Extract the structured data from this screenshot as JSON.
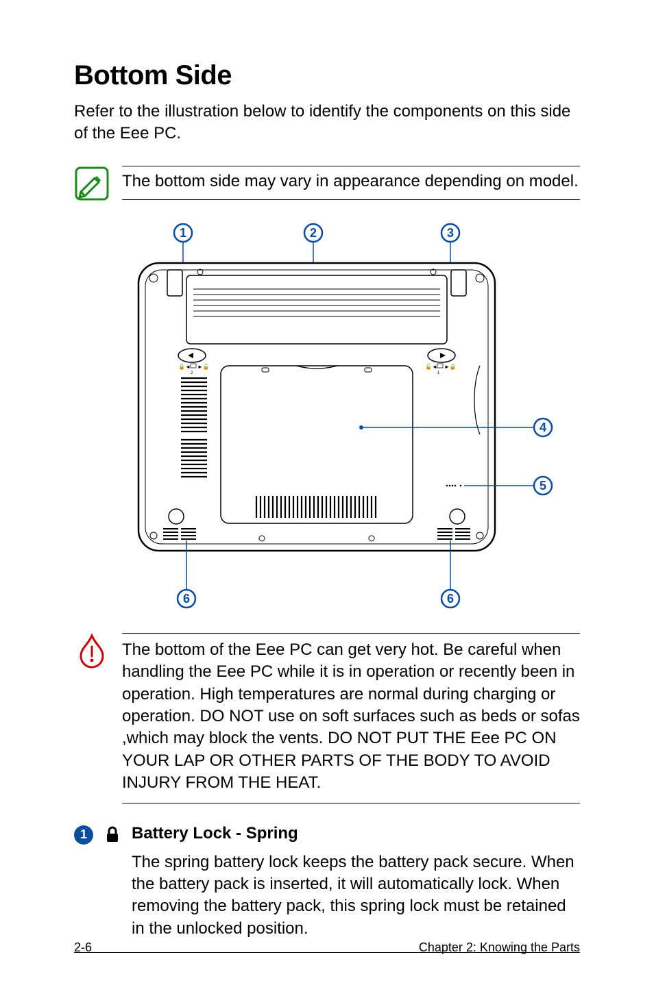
{
  "title": "Bottom Side",
  "intro": "Refer to the illustration below to identify the components on this side of the Eee PC.",
  "note": {
    "text": "The bottom side may vary in appearance depending on model."
  },
  "diagram": {
    "callouts": [
      "1",
      "2",
      "3",
      "4",
      "5",
      "6",
      "6"
    ]
  },
  "warning": {
    "text": "The bottom of the Eee PC can get very hot. Be careful when handling the Eee PC while it is in operation or recently been in operation. High temperatures are normal during charging or operation. DO NOT use on soft surfaces such as beds or sofas ,which may block the vents. DO NOT PUT THE Eee PC ON YOUR LAP OR OTHER PARTS OF THE BODY TO AVOID INJURY FROM THE HEAT."
  },
  "items": [
    {
      "number": "1",
      "title": "Battery Lock - Spring",
      "desc": "The spring battery lock keeps the battery pack secure. When the battery pack is inserted, it will automatically lock. When removing the battery pack, this spring lock must be retained in the unlocked position."
    }
  ],
  "footer": {
    "page": "2-6",
    "chapter": "Chapter 2: Knowing the Parts"
  }
}
